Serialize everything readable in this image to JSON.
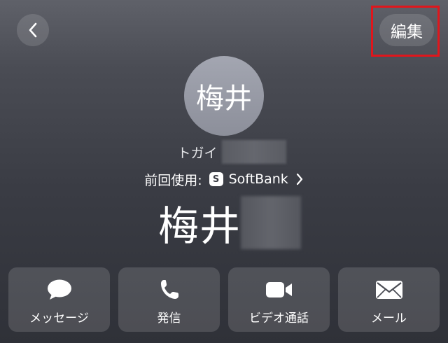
{
  "header": {
    "back_icon": "chevron-left-icon",
    "edit_label": "編集",
    "highlight_color": "#e0161c"
  },
  "contact": {
    "avatar_initials": "梅井",
    "reading": "トガイ",
    "last_used_label": "前回使用:",
    "sim_badge": "S",
    "carrier": "SoftBank",
    "name": "梅井"
  },
  "actions": [
    {
      "label": "メッセージ",
      "icon": "message-bubble-icon"
    },
    {
      "label": "発信",
      "icon": "phone-icon"
    },
    {
      "label": "ビデオ通話",
      "icon": "video-camera-icon"
    },
    {
      "label": "メール",
      "icon": "envelope-icon"
    }
  ]
}
